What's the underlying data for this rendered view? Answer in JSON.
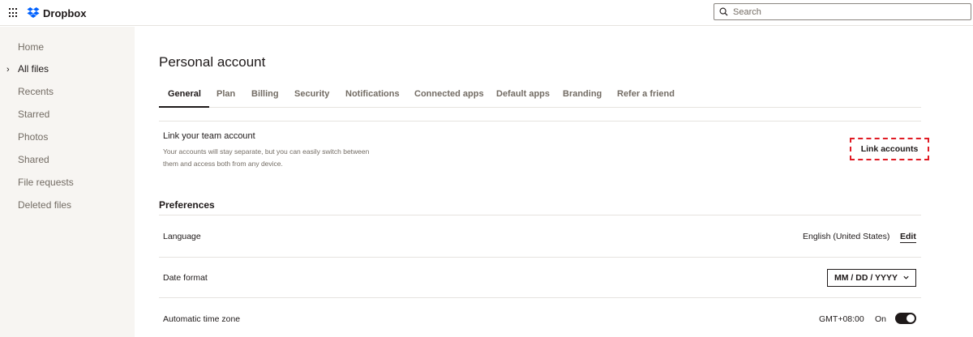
{
  "header": {
    "app_name": "Dropbox",
    "search_placeholder": "Search",
    "brand_color": "#0061fe"
  },
  "sidebar": {
    "items": [
      {
        "label": "Home"
      },
      {
        "label": "All files"
      },
      {
        "label": "Recents"
      },
      {
        "label": "Starred"
      },
      {
        "label": "Photos"
      },
      {
        "label": "Shared"
      },
      {
        "label": "File requests"
      },
      {
        "label": "Deleted files"
      }
    ],
    "expanded_item_icon": "chevron-right-icon"
  },
  "main": {
    "title": "Personal account",
    "tabs": [
      {
        "label": "General",
        "active": true
      },
      {
        "label": "Plan"
      },
      {
        "label": "Billing"
      },
      {
        "label": "Security"
      },
      {
        "label": "Notifications"
      },
      {
        "label": "Connected apps"
      },
      {
        "label": "Default apps"
      },
      {
        "label": "Branding"
      },
      {
        "label": "Refer a friend"
      }
    ],
    "link_section": {
      "title": "Link your team account",
      "description_line1": "Your accounts will stay separate, but you can easily switch between",
      "description_line2": "them and access both from any device.",
      "button_label": "Link accounts",
      "highlight_color": "#e01b24"
    },
    "preferences": {
      "title": "Preferences",
      "language": {
        "label": "Language",
        "value": "English (United States)",
        "edit_label": "Edit"
      },
      "date_format": {
        "label": "Date format",
        "value": "MM / DD / YYYY"
      },
      "time_zone": {
        "label": "Automatic time zone",
        "value": "GMT+08:00",
        "toggle_label": "On",
        "toggle_on": true
      }
    }
  }
}
